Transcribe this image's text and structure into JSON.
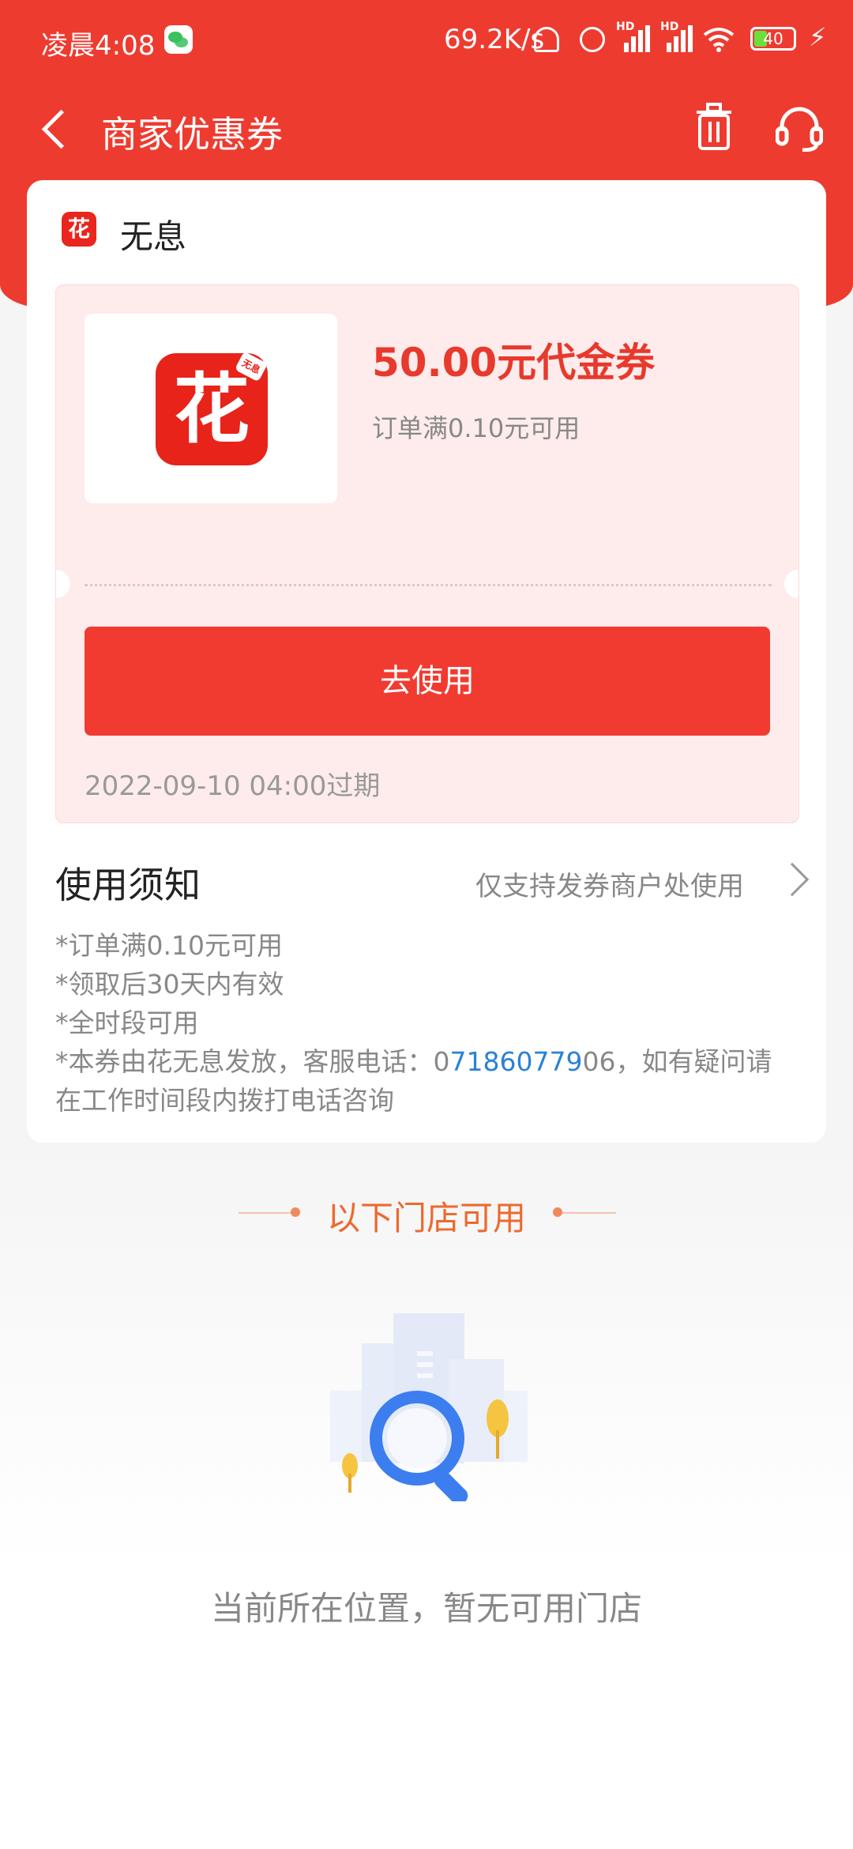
{
  "status_bar": {
    "time": "凌晨4:08",
    "speed": "69.2K/s",
    "battery": "40",
    "hd_label": "HD"
  },
  "nav": {
    "title": "商家优惠券"
  },
  "merchant": {
    "logo_char": "花",
    "name": "无息"
  },
  "coupon": {
    "logo_char": "花",
    "logo_tag": "无息",
    "amount": "50.00元代金券",
    "condition": "订单满0.10元可用",
    "use_button": "去使用",
    "expiry": "2022-09-10 04:00过期"
  },
  "notice": {
    "title": "使用须知",
    "scope": "仅支持发券商户处使用",
    "items": [
      "*订单满0.10元可用",
      "*领取后30天内有效",
      "*全时段可用"
    ],
    "item4_prefix": "*本券由花无息发放，客服电话：0",
    "item4_phone": "71860779",
    "item4_suffix": "06，如有疑问请在工作时间段内拨打电话咨询"
  },
  "stores": {
    "header": "以下门店可用",
    "empty_text": "当前所在位置，暂无可用门店"
  },
  "colors": {
    "brand_red": "#ee3b30",
    "button_red": "#f13b31",
    "amount_red": "#e8392d",
    "stores_orange": "#ec6a2e",
    "link_blue": "#2a82d4"
  }
}
